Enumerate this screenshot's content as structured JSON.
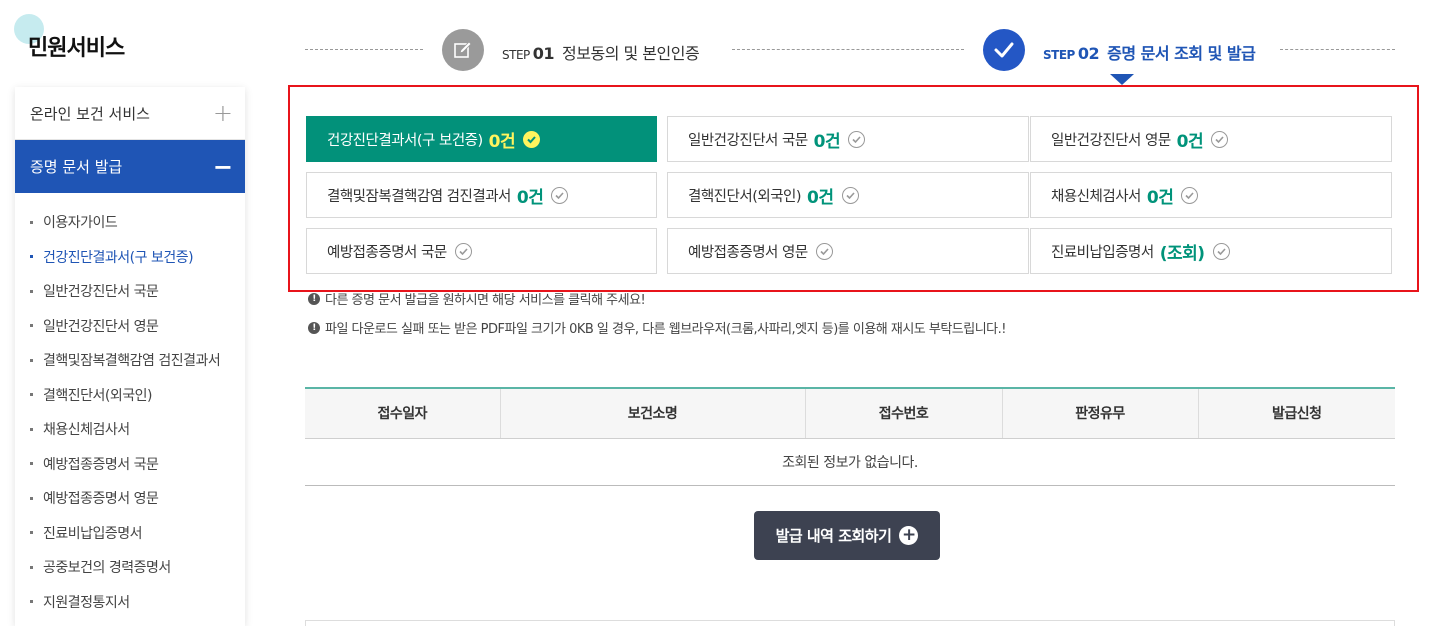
{
  "sidebar": {
    "title": "민원서비스",
    "menu": [
      {
        "label": "온라인 보건 서비스",
        "sign": "+"
      },
      {
        "label": "증명 문서 발급",
        "sign": "−"
      }
    ],
    "sub_items": [
      "이용자가이드",
      "건강진단결과서(구 보건증)",
      "일반건강진단서 국문",
      "일반건강진단서 영문",
      "결핵및잠복결핵감염 검진결과서",
      "결핵진단서(외국인)",
      "채용신체검사서",
      "예방접종증명서 국문",
      "예방접종증명서 영문",
      "진료비납입증명서",
      "공중보건의 경력증명서",
      "지원결정통지서"
    ],
    "active_sub_index": 1
  },
  "steps": [
    {
      "word": "STEP",
      "num": "01",
      "label": "정보동의 및 본인인증",
      "icon": "pencil-edit-icon",
      "state": "done"
    },
    {
      "word": "STEP",
      "num": "02",
      "label": "증명 문서 조회 및 발급",
      "icon": "checkmark-icon",
      "state": "current"
    }
  ],
  "certificates": [
    {
      "label": "건강진단결과서(구 보건증)",
      "count": "0건",
      "active": true
    },
    {
      "label": "일반건강진단서 국문",
      "count": "0건",
      "active": false
    },
    {
      "label": "일반건강진단서 영문",
      "count": "0건",
      "active": false
    },
    {
      "label": "결핵및잠복결핵감염 검진결과서",
      "count": "0건",
      "active": false
    },
    {
      "label": "결핵진단서(외국인)",
      "count": "0건",
      "active": false
    },
    {
      "label": "채용신체검사서",
      "count": "0건",
      "active": false
    },
    {
      "label": "예방접종증명서 국문",
      "count": "",
      "active": false
    },
    {
      "label": "예방접종증명서 영문",
      "count": "",
      "active": false
    },
    {
      "label": "진료비납입증명서",
      "count": "(조회)",
      "active": false
    }
  ],
  "notices": [
    "다른 증명 문서 발급을 원하시면 해당 서비스를 클릭해 주세요!",
    "파일 다운로드 실패 또는 받은 PDF파일 크기가 0KB 일 경우, 다른 웹브라우저(크롬,사파리,엣지 등)를 이용해 재시도 부탁드립니다.!"
  ],
  "table": {
    "headers": [
      "접수일자",
      "보건소명",
      "접수번호",
      "판정유무",
      "발급신청"
    ],
    "empty_message": "조회된 정보가 없습니다."
  },
  "search_button": {
    "label": "발급 내역 조회하기",
    "icon": "plus-circle-icon"
  },
  "colors": {
    "primary_blue": "#1f55b5",
    "active_green": "#02917a",
    "count_green": "#00937a",
    "highlight_yellow": "#fff45e",
    "alert_red": "#e8141b"
  }
}
